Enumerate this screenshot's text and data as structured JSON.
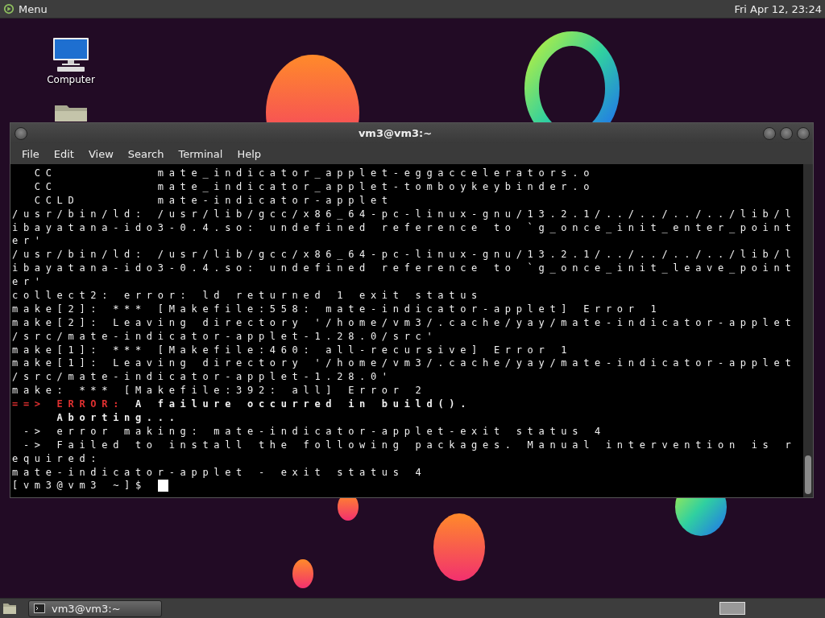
{
  "top_panel": {
    "menu_label": "Menu",
    "clock": "Fri Apr 12, 23:24"
  },
  "desktop_icons": [
    {
      "kind": "computer",
      "label": "Computer"
    },
    {
      "kind": "folder"
    }
  ],
  "window": {
    "title": "vm3@vm3:~",
    "menu": [
      "File",
      "Edit",
      "View",
      "Search",
      "Terminal",
      "Help"
    ],
    "terminal": {
      "lines": [
        [
          {
            "text": "  CC         mate_indicator_applet-eggaccelerators.o",
            "kind": "plain"
          }
        ],
        [
          {
            "text": "  CC         mate_indicator_applet-tomboykeybinder.o",
            "kind": "plain"
          }
        ],
        [
          {
            "text": "  CCLD       mate-indicator-applet",
            "kind": "plain"
          }
        ],
        [
          {
            "text": "/usr/bin/ld: /usr/lib/gcc/x86_64-pc-linux-gnu/13.2.1/../../../../lib/l",
            "kind": "plain"
          }
        ],
        [
          {
            "text": "ibayatana-ido3-0.4.so: undefined reference to `g_once_init_enter_point",
            "kind": "plain"
          }
        ],
        [
          {
            "text": "er'",
            "kind": "plain"
          }
        ],
        [
          {
            "text": "/usr/bin/ld: /usr/lib/gcc/x86_64-pc-linux-gnu/13.2.1/../../../../lib/l",
            "kind": "plain"
          }
        ],
        [
          {
            "text": "ibayatana-ido3-0.4.so: undefined reference to `g_once_init_leave_point",
            "kind": "plain"
          }
        ],
        [
          {
            "text": "er'",
            "kind": "plain"
          }
        ],
        [
          {
            "text": "collect2: error: ld returned 1 exit status",
            "kind": "plain"
          }
        ],
        [
          {
            "text": "make[2]: *** [Makefile:558: mate-indicator-applet] Error 1",
            "kind": "plain"
          }
        ],
        [
          {
            "text": "make[2]: Leaving directory '/home/vm3/.cache/yay/mate-indicator-applet",
            "kind": "plain"
          }
        ],
        [
          {
            "text": "/src/mate-indicator-applet-1.28.0/src'",
            "kind": "plain"
          }
        ],
        [
          {
            "text": "make[1]: *** [Makefile:460: all-recursive] Error 1",
            "kind": "plain"
          }
        ],
        [
          {
            "text": "make[1]: Leaving directory '/home/vm3/.cache/yay/mate-indicator-applet",
            "kind": "plain"
          }
        ],
        [
          {
            "text": "/src/mate-indicator-applet-1.28.0'",
            "kind": "plain"
          }
        ],
        [
          {
            "text": "make: *** [Makefile:392: all] Error 2",
            "kind": "plain"
          }
        ],
        [
          {
            "text": "==> ERROR:",
            "kind": "error"
          },
          {
            "text": " A failure occurred in build().",
            "kind": "bold"
          }
        ],
        [
          {
            "text": "    Aborting...",
            "kind": "bold"
          }
        ],
        [
          {
            "text": " -> error making: mate-indicator-applet-exit status 4",
            "kind": "plain"
          }
        ],
        [
          {
            "text": " -> Failed to install the following packages. Manual intervention is r",
            "kind": "plain"
          }
        ],
        [
          {
            "text": "equired:",
            "kind": "plain"
          }
        ],
        [
          {
            "text": "mate-indicator-applet - exit status 4",
            "kind": "plain"
          }
        ],
        [
          {
            "text": "[vm3@vm3 ~]$ ",
            "kind": "plain"
          }
        ]
      ]
    }
  },
  "taskbar": {
    "tasks": [
      {
        "label": "vm3@vm3:~",
        "selected": true
      }
    ]
  }
}
